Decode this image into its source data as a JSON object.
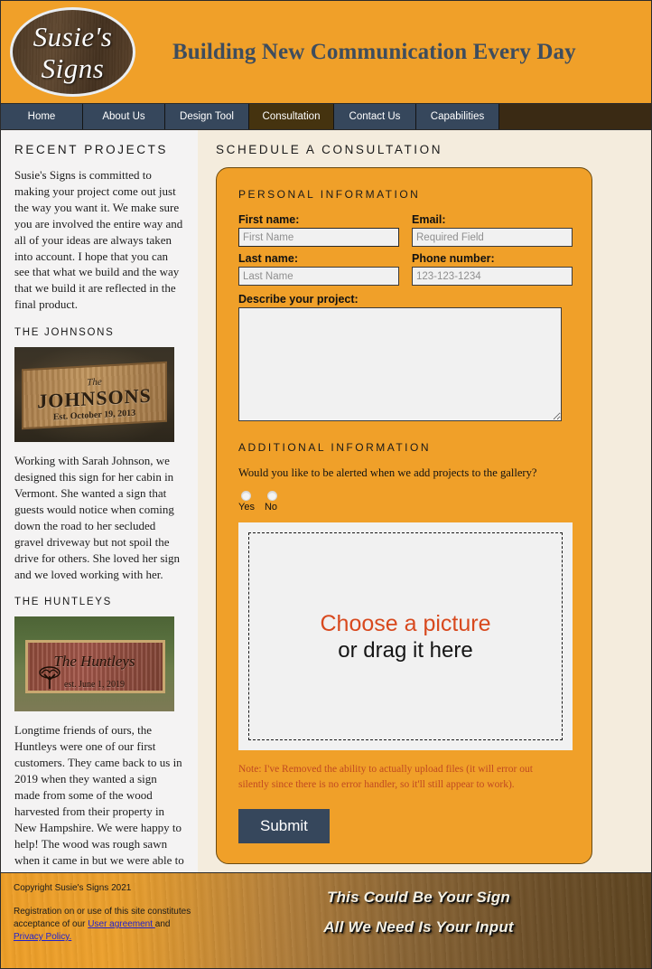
{
  "header": {
    "logo_line1": "Susie's",
    "logo_line2": "Signs",
    "title": "Building New Communication Every Day"
  },
  "nav": {
    "items": [
      {
        "label": "Home",
        "active": false,
        "width": 91
      },
      {
        "label": "About Us",
        "active": false,
        "width": 91
      },
      {
        "label": "Design Tool",
        "active": false,
        "width": 93
      },
      {
        "label": "Consultation",
        "active": true,
        "width": 94
      },
      {
        "label": "Contact Us",
        "active": false,
        "width": 91
      },
      {
        "label": "Capabilities",
        "active": false,
        "width": 92
      }
    ]
  },
  "sidebar": {
    "heading": "RECENT PROJECTS",
    "intro": "Susie's Signs is committed to making your project come out just the way you want it. We make sure you are involved the entire way and all of your ideas are always taken into account. I hope that you can see that what we build and the way that we build it are reflected in the final product.",
    "projects": [
      {
        "title": "THE JOHNSONS",
        "image_alt": "wooden sign reading The JOHNSONS Est. October 19, 2013",
        "sign_the": "The",
        "sign_name": "JOHNSONS",
        "sign_est": "Est. October 19, 2013",
        "text": "Working with Sarah Johnson, we designed this sign for her cabin in Vermont. She wanted a sign that guests would notice when coming down the road to her secluded gravel driveway but not spoil the drive for others. She loved her sign and we loved working with her."
      },
      {
        "title": "THE HUNTLEYS",
        "image_alt": "red cedar sign reading The Huntleys est. June 1, 2019",
        "sign_name": "The Huntleys",
        "sign_est": "est. June 1, 2019",
        "text": "Longtime friends of ours, the Huntleys were one of our first customers. They came back to us in 2019 when they wanted a sign made from some of the wood harvested from their property in New Hampshire. We were happy to help! The wood was rough sawn when it came in but we were able to producte a great piece of art for them to hang at the house in Massachusetts."
      }
    ]
  },
  "main": {
    "heading": "SCHEDULE A CONSULTATION",
    "form": {
      "personal_heading": "PERSONAL INFORMATION",
      "first_name_label": "First name:",
      "first_name_placeholder": "First Name",
      "first_name_value": "",
      "email_label": "Email:",
      "email_placeholder": "Required Field",
      "email_value": "",
      "last_name_label": "Last name:",
      "last_name_placeholder": "Last Name",
      "last_name_value": "",
      "phone_label": "Phone number:",
      "phone_placeholder": "123-123-1234",
      "phone_value": "",
      "project_label": "Describe your project:",
      "project_value": "",
      "additional_heading": "ADDITIONAL INFORMATION",
      "alert_question": "Would you like to be alerted when we add projects to the gallery?",
      "radio_yes": "Yes",
      "radio_no": "No",
      "dropzone_line1": "Choose a picture",
      "dropzone_line2": "or drag it here",
      "upload_note": "Note: I've Removed the ability to actually upload files (it will error out silently since there is no error handler, so it'll still appear to work).",
      "submit_label": "Submit"
    }
  },
  "footer": {
    "copyright": "Copyright Susie's Signs 2021",
    "registration_prefix": "Registration on or use of this site constitutes acceptance of our ",
    "user_agreement_link": "User agreement ",
    "registration_mid": "and ",
    "privacy_link": "Privacy Policy.",
    "slogan_line1": "This Could Be Your Sign",
    "slogan_line2": "All We Need Is Your Input"
  },
  "colors": {
    "brand_orange": "#f0a029",
    "nav_blue": "#36475c",
    "nav_active_brown": "#45330f",
    "page_cream": "#f4ecdd",
    "accent_red": "#d8491e",
    "note_red": "#c04a22",
    "link_blue": "#2222cc"
  }
}
